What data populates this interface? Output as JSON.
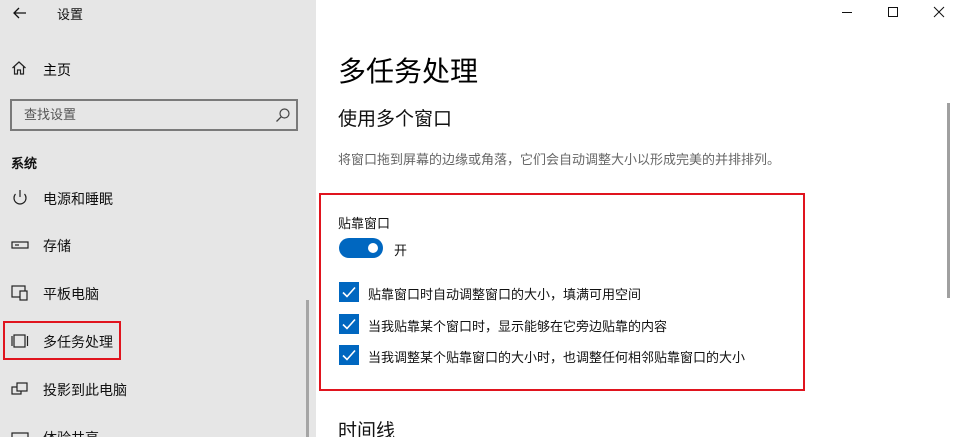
{
  "app": {
    "title": "设置"
  },
  "nav": {
    "home": "主页",
    "search_placeholder": "查找设置",
    "section": "系统",
    "items": [
      {
        "label": "电源和睡眠",
        "icon": "power-icon"
      },
      {
        "label": "存储",
        "icon": "storage-icon"
      },
      {
        "label": "平板电脑",
        "icon": "tablet-icon"
      },
      {
        "label": "多任务处理",
        "icon": "multitasking-icon"
      },
      {
        "label": "投影到此电脑",
        "icon": "project-icon"
      },
      {
        "label": "体验共享",
        "icon": "share-icon"
      }
    ],
    "selected": "多任务处理"
  },
  "main": {
    "title": "多任务处理",
    "subtitle": "使用多个窗口",
    "description": "将窗口拖到屏幕的边缘或角落，它们会自动调整大小以形成完美的并排排列。",
    "snap": {
      "label": "贴靠窗口",
      "toggle_state": "开",
      "toggle_on": true,
      "options": [
        {
          "label": "贴靠窗口时自动调整窗口的大小，填满可用空间",
          "checked": true
        },
        {
          "label": "当我贴靠某个窗口时，显示能够在它旁边贴靠的内容",
          "checked": true
        },
        {
          "label": "当我调整某个贴靠窗口的大小时，也调整任何相邻贴靠窗口的大小",
          "checked": true
        }
      ]
    },
    "timeline_title": "时间线"
  },
  "colors": {
    "accent": "#0067c0",
    "highlight": "#e0141e",
    "sidebar_bg": "#e6e6e6"
  }
}
